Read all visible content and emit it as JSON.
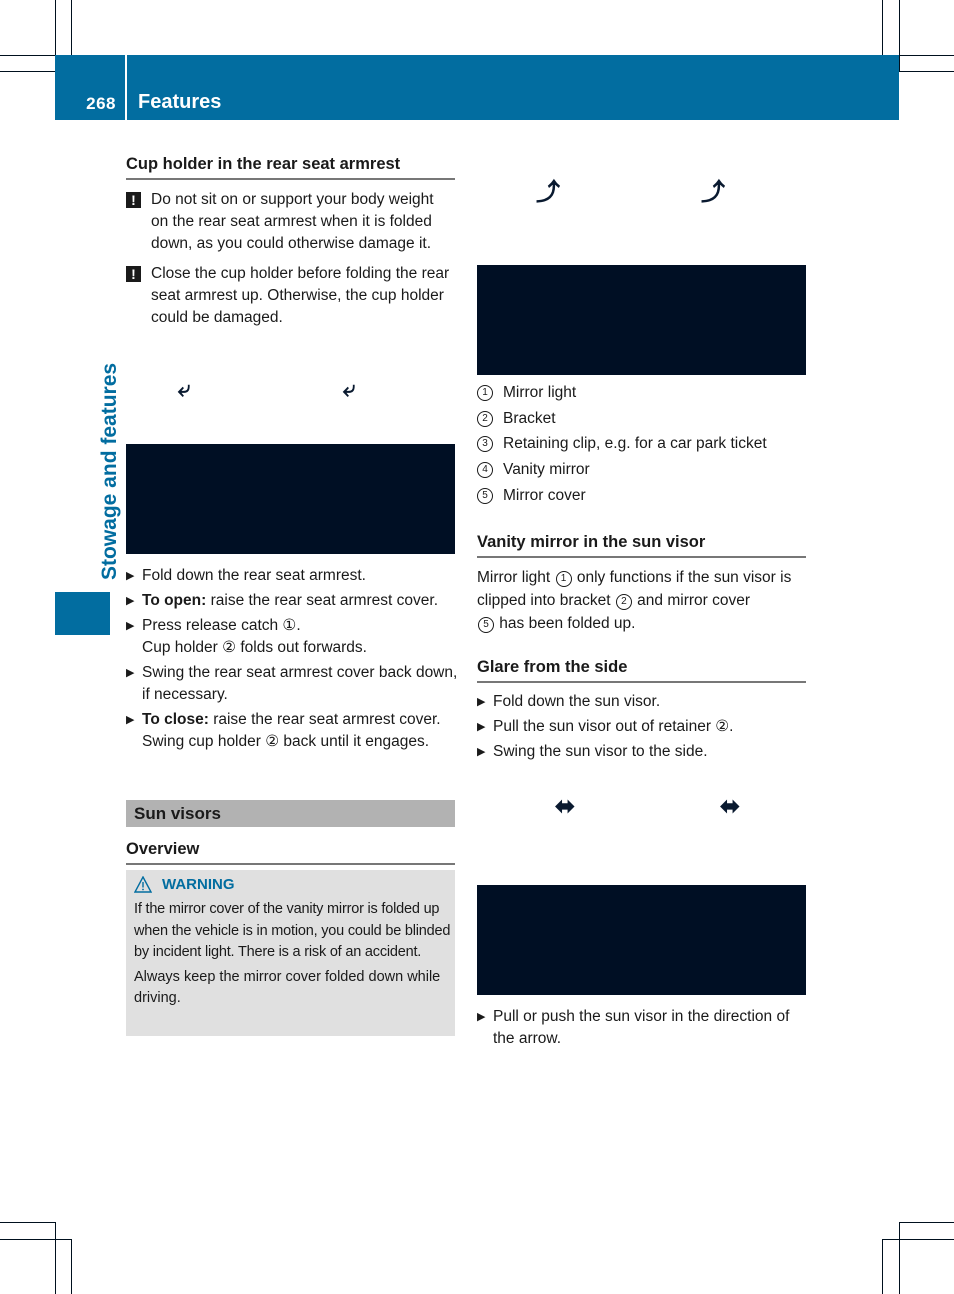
{
  "header": {
    "page_number": "268",
    "title": "Features",
    "brand_color": "#026da0"
  },
  "side_tab": {
    "label": "Stowage and features"
  },
  "left_column": {
    "cup_holder": {
      "heading": "Cup holder in the rear seat armrest",
      "notes": [
        {
          "icon": "exclamation-icon",
          "text": "Do not sit on or support your body weight on the rear seat armrest when it is folded down, as you could otherwise damage it."
        },
        {
          "icon": "exclamation-icon",
          "text": "Close the cup holder before folding the rear seat armrest up. Otherwise, the cup holder could be damaged."
        }
      ],
      "steps": [
        {
          "bold": "",
          "text": "Fold down the rear seat armrest.",
          "extra": ""
        },
        {
          "bold": "To open:",
          "text": " raise the rear seat armrest cover.",
          "extra": ""
        },
        {
          "bold": "",
          "text": "Press release catch ①.",
          "extra": "Cup holder ② folds out forwards."
        },
        {
          "bold": "",
          "text": "Swing the rear seat armrest cover back down, if necessary.",
          "extra": ""
        },
        {
          "bold": "To close:",
          "text": " raise the rear seat armrest cover.",
          "extra": "Swing cup holder ② back until it engages."
        }
      ]
    },
    "sun_visors": {
      "section_title": "Sun visors",
      "overview_heading": "Overview",
      "warning": {
        "label": "WARNING",
        "text1": "If the mirror cover of the vanity mirror is folded up when the vehicle is in motion, you could be blinded by incident light. There is a risk of an accident.",
        "text2": "Always keep the mirror cover folded down while driving."
      }
    }
  },
  "right_column": {
    "legend": [
      {
        "num": "1",
        "label": "Mirror light"
      },
      {
        "num": "2",
        "label": "Bracket"
      },
      {
        "num": "3",
        "label": "Retaining clip, e.g. for a car park ticket"
      },
      {
        "num": "4",
        "label": "Vanity mirror"
      },
      {
        "num": "5",
        "label": "Mirror cover"
      }
    ],
    "vanity": {
      "heading": "Vanity mirror in the sun visor",
      "text_a": "Mirror light ",
      "c1": "1",
      "text_b": " only functions if the sun visor is clipped into bracket ",
      "c2": "2",
      "text_c": " and mirror cover ",
      "c3": "5",
      "text_d": " has been folded up."
    },
    "glare": {
      "heading": "Glare from the side",
      "steps": [
        "Fold down the sun visor.",
        "Pull the sun visor out of retainer ②.",
        "Swing the sun visor to the side."
      ],
      "final_step": "Pull or push the sun visor in the direction of the arrow."
    }
  }
}
